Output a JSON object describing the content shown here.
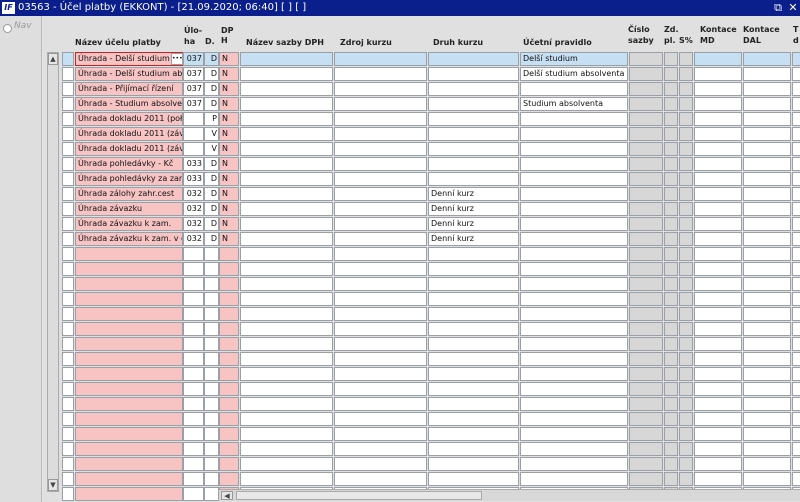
{
  "window": {
    "title": "03563 - Účel platby (EKKONT) - [21.09.2020; 06:40]  [ ]  [ ]",
    "logo_text": "IF",
    "restore_glyph": "⧉",
    "close_glyph": "✕"
  },
  "nav": {
    "label": "Nav"
  },
  "scroll": {
    "up": "▲",
    "down": "▼",
    "left": "◀"
  },
  "columns": [
    {
      "key": "name",
      "line1": "Název účelu platby",
      "line2": ""
    },
    {
      "key": "uloha",
      "line1": "Úlo-",
      "line2": "ha"
    },
    {
      "key": "d",
      "line1": "",
      "line2": "D."
    },
    {
      "key": "dph",
      "line1": "DP",
      "line2": "H"
    },
    {
      "key": "sazba",
      "line1": "Název sazby DPH",
      "line2": ""
    },
    {
      "key": "zdroj",
      "line1": "Zdroj kurzu",
      "line2": ""
    },
    {
      "key": "druh",
      "line1": "Druh kurzu",
      "line2": ""
    },
    {
      "key": "pravidlo",
      "line1": "Účetní pravidlo",
      "line2": ""
    },
    {
      "key": "cislo",
      "line1": "Číslo",
      "line2": "sazby"
    },
    {
      "key": "zd",
      "line1": "Zd.",
      "line2": "pl."
    },
    {
      "key": "s",
      "line1": "",
      "line2": "S%"
    },
    {
      "key": "md",
      "line1": "Kontace",
      "line2": "MD"
    },
    {
      "key": "dal",
      "line1": "Kontace",
      "line2": "DAL"
    },
    {
      "key": "t",
      "line1": "T",
      "line2": "d"
    }
  ],
  "rows": [
    {
      "name": "Úhrada - Delší studium",
      "uloha": "037",
      "d": "D",
      "dph": "N",
      "druh": "",
      "pravidlo": "Delší studium"
    },
    {
      "name": "Úhrada - Delší studium ab",
      "uloha": "037",
      "d": "D",
      "dph": "N",
      "druh": "",
      "pravidlo": "Delší studium absolventa"
    },
    {
      "name": "Úhrada - Přijímací řízení",
      "uloha": "037",
      "d": "D",
      "dph": "N",
      "druh": "",
      "pravidlo": ""
    },
    {
      "name": "Úhrada - Studium absolve",
      "uloha": "037",
      "d": "D",
      "dph": "N",
      "druh": "",
      "pravidlo": "Studium absolventa"
    },
    {
      "name": "Úhrada dokladu 2011 (poł",
      "uloha": "",
      "d": "P",
      "dph": "N",
      "druh": "",
      "pravidlo": ""
    },
    {
      "name": "Úhrada dokladu 2011 (záv",
      "uloha": "",
      "d": "V",
      "dph": "N",
      "druh": "",
      "pravidlo": ""
    },
    {
      "name": "Úhrada dokladu 2011 (záv",
      "uloha": "",
      "d": "V",
      "dph": "N",
      "druh": "",
      "pravidlo": ""
    },
    {
      "name": "Úhrada pohledávky  - Kč",
      "uloha": "033",
      "d": "D",
      "dph": "N",
      "druh": "",
      "pravidlo": ""
    },
    {
      "name": "Úhrada pohledávky za zar",
      "uloha": "033",
      "d": "D",
      "dph": "N",
      "druh": "",
      "pravidlo": ""
    },
    {
      "name": "Úhrada zálohy zahr.cest",
      "uloha": "032",
      "d": "D",
      "dph": "N",
      "druh": "Denní kurz",
      "pravidlo": ""
    },
    {
      "name": "Úhrada závazku",
      "uloha": "032",
      "d": "D",
      "dph": "N",
      "druh": "Denní kurz",
      "pravidlo": ""
    },
    {
      "name": "Úhrada závazku k zam.",
      "uloha": "032",
      "d": "D",
      "dph": "N",
      "druh": "Denní kurz",
      "pravidlo": ""
    },
    {
      "name": "Úhrada závazku k zam. v c",
      "uloha": "032",
      "d": "D",
      "dph": "N",
      "druh": "Denní kurz",
      "pravidlo": ""
    }
  ],
  "ellipsis_button": "•••",
  "colors": {
    "title_bar": "#0a1e8c",
    "required_cell": "#f7c3c3",
    "selected_row": "#c6dff3",
    "readonly_cell": "#d7d7d7"
  }
}
